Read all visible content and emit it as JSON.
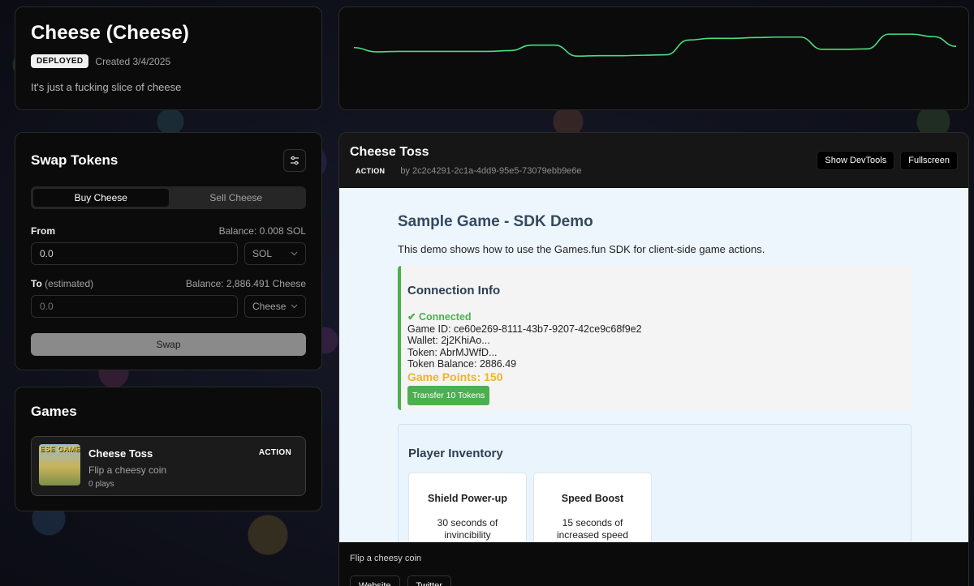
{
  "token": {
    "title": "Cheese (Cheese)",
    "status": "DEPLOYED",
    "created": "Created 3/4/2025",
    "description": "It's just a fucking slice of cheese"
  },
  "price_chart": {
    "color": "#4ade80",
    "values": [
      0.62,
      0.52,
      0.53,
      0.53,
      0.53,
      0.53,
      0.53,
      0.55,
      0.68,
      0.68,
      0.42,
      0.43,
      0.43,
      0.44,
      0.45,
      0.8,
      0.84,
      0.84,
      0.86,
      0.87,
      0.87,
      0.58,
      0.58,
      0.59,
      0.94,
      0.94,
      0.88,
      0.65
    ]
  },
  "swap": {
    "title": "Swap Tokens",
    "tabs": [
      "Buy Cheese",
      "Sell Cheese"
    ],
    "from_label": "From",
    "from_balance": "Balance: 0.008 SOL",
    "from_value": "0.0",
    "from_token": "SOL",
    "to_label": "To",
    "to_suffix": "(estimated)",
    "to_balance": "Balance: 2,886.491 Cheese",
    "to_placeholder": "0.0",
    "to_token": "Cheese",
    "swap_label": "Swap"
  },
  "games": {
    "title": "Games",
    "items": [
      {
        "thumb_text": "ESE GAME",
        "title": "Cheese Toss",
        "category": "ACTION",
        "description": "Flip a cheesy coin",
        "plays": "0 plays"
      }
    ]
  },
  "game_panel": {
    "title": "Cheese Toss",
    "category": "ACTION",
    "by": "by 2c2c4291-2c1a-4dd9-95e5-73079ebb9e6e",
    "devtools_label": "Show DevTools",
    "fullscreen_label": "Fullscreen",
    "footer_description": "Flip a cheesy coin",
    "links": [
      "Website",
      "Twitter"
    ]
  },
  "demo": {
    "heading": "Sample Game - SDK Demo",
    "intro": "This demo shows how to use the Games.fun SDK for client-side game actions.",
    "connection": {
      "title": "Connection Info",
      "status": "✔ Connected",
      "game_id": "Game ID: ce60e269-8111-43b7-9207-42ce9c68f9e2",
      "wallet": "Wallet: 2j2KhiAo...",
      "token": "Token: AbrMJWfD...",
      "balance": "Token Balance: 2886.49",
      "points": "Game Points: 150",
      "transfer_label": "Transfer 10 Tokens"
    },
    "inventory": {
      "title": "Player Inventory",
      "items": [
        {
          "name": "Shield Power-up",
          "description": "30 seconds of invincibility"
        },
        {
          "name": "Speed Boost",
          "description": "15 seconds of increased speed"
        }
      ]
    }
  }
}
